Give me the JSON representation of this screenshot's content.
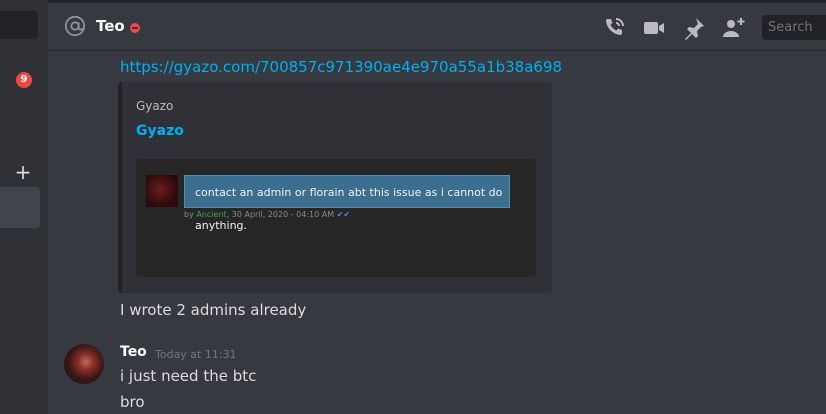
{
  "sidebar": {
    "badge_count": "9",
    "add_label": "+"
  },
  "header": {
    "channel_name": "Teo",
    "status": "do-not-disturb",
    "icons": [
      "at-icon",
      "call-icon",
      "video-icon",
      "pin-icon",
      "add-friend-icon"
    ],
    "search_placeholder": "Search"
  },
  "messages": {
    "link": "https://gyazo.com/700857c971390ae4e970a55a1b38a698",
    "embed": {
      "provider": "Gyazo",
      "title": "Gyazo",
      "image": {
        "bubble_text": "contact an admin or florain abt this issue as i cannot do anything.",
        "by_prefix": "by",
        "author": "Ancient",
        "date": ", 30 April, 2020 - 04:10 AM",
        "tick": "✔✔"
      }
    },
    "followup": "I wrote 2 admins already",
    "group": {
      "author": "Teo",
      "timestamp": "Today at 11:31",
      "lines": [
        "i just need the btc",
        "bro"
      ]
    }
  },
  "colors": {
    "background": "#36393f",
    "sidebar": "#2f3136",
    "link": "#00b0f4",
    "badge": "#f04747"
  }
}
